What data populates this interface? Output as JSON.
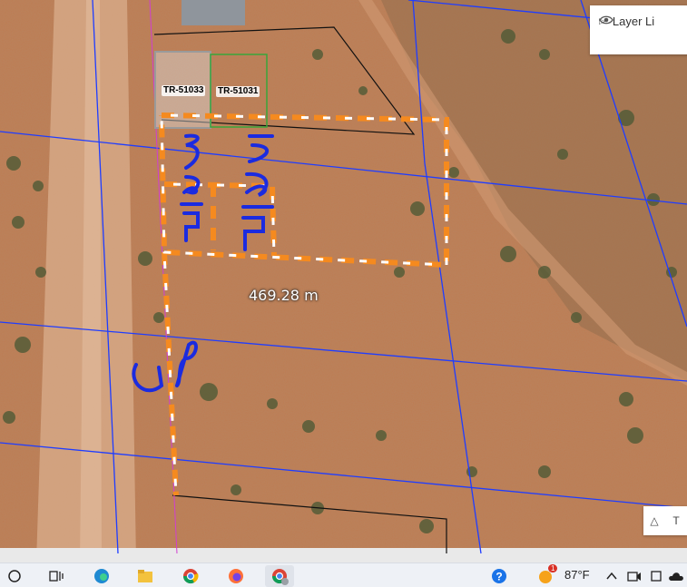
{
  "map": {
    "parcel_labels": [
      "TR-51033",
      "TR-51031"
    ],
    "measurement": "469.28 m",
    "handwritten": [
      "51033",
      "51031",
      "JP"
    ]
  },
  "layer_panel": {
    "label": "Layer Li"
  },
  "corner_controls": {
    "collapse_symbol": "△",
    "tools_label": "T"
  },
  "taskbar": {
    "weather_temp": "87°F",
    "notification_count": "1",
    "apps": [
      "file-explorer",
      "edge",
      "file-manager",
      "chrome",
      "firefox",
      "chrome-alt"
    ]
  },
  "colors": {
    "terrain": "#b9794f",
    "parcel_line_blue": "#1f3dff",
    "highlight_orange": "#f58a1f",
    "ink_blue": "#1b2be0"
  }
}
